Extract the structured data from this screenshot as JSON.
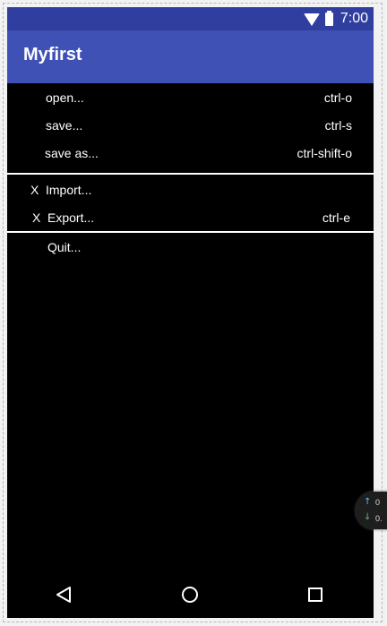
{
  "status_bar": {
    "time": "7:00",
    "icons": [
      "wifi-icon",
      "battery-icon"
    ]
  },
  "app_bar": {
    "title": "Myfirst"
  },
  "menu": {
    "groups": [
      {
        "items": [
          {
            "label": "open...",
            "shortcut": "ctrl-o"
          },
          {
            "label": "save...",
            "shortcut": "ctrl-s"
          },
          {
            "label": "save as...",
            "shortcut": "ctrl-shift-o"
          }
        ]
      },
      {
        "items": [
          {
            "mark": "X",
            "label": "Import...",
            "shortcut": ""
          },
          {
            "mark": "X",
            "label": "Export...",
            "shortcut": "ctrl-e"
          }
        ]
      },
      {
        "items": [
          {
            "label": "Quit...",
            "shortcut": ""
          }
        ]
      }
    ]
  },
  "floating_widget": {
    "upload_value": "0",
    "download_value": "0."
  },
  "colors": {
    "status_bar": "#303f9f",
    "app_bar": "#3f51b5",
    "menu_background": "#000000",
    "text": "#ffffff"
  }
}
